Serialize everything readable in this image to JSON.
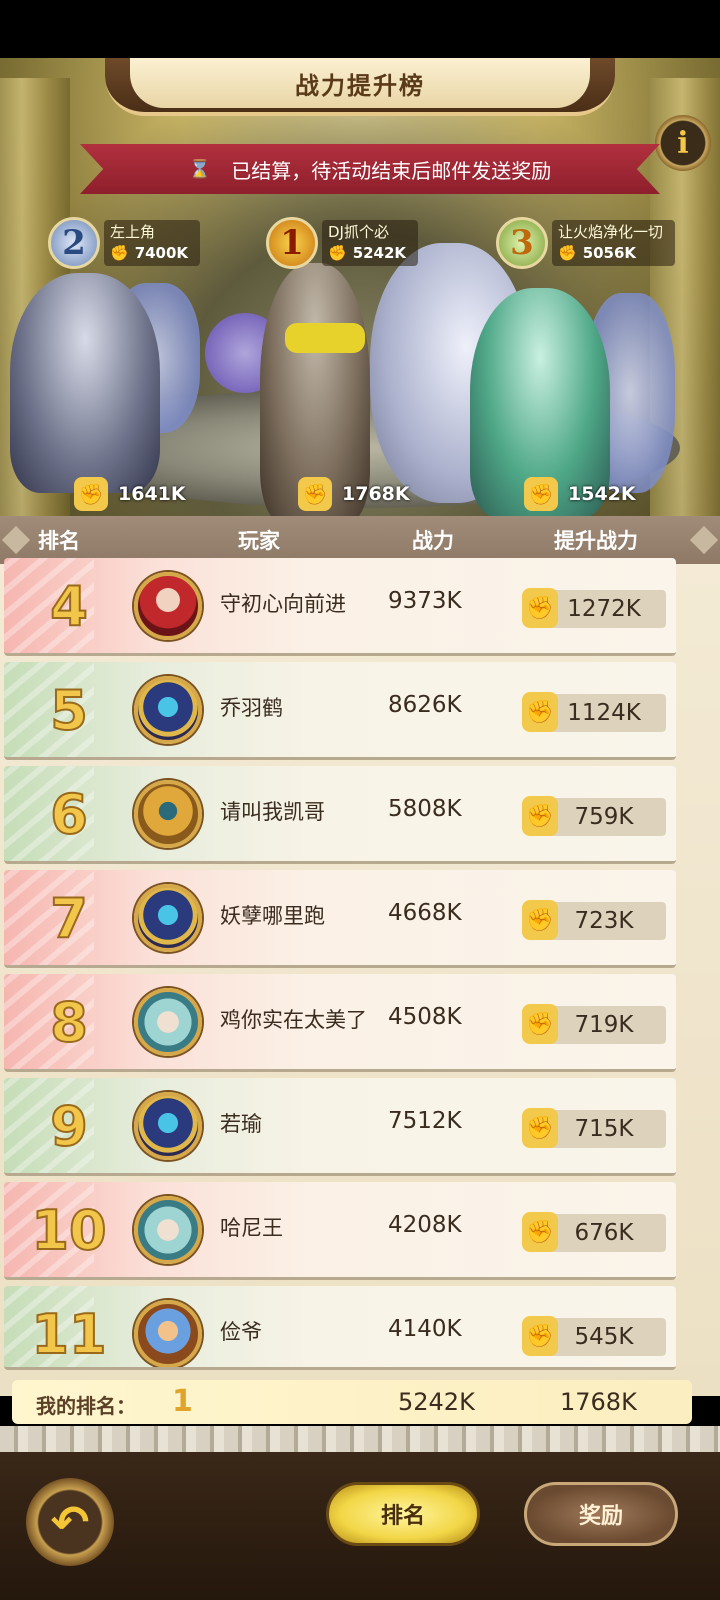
{
  "header": {
    "title": "战力提升榜",
    "info_icon": "i",
    "notice": "已结算，待活动结束后邮件发送奖励"
  },
  "top3": [
    {
      "rank": "2",
      "name": "左上角",
      "power": "7400K",
      "gain": "1641K"
    },
    {
      "rank": "1",
      "name": "DJ抓个必",
      "power": "5242K",
      "gain": "1768K"
    },
    {
      "rank": "3",
      "name": "让火焰净化一切",
      "power": "5056K",
      "gain": "1542K"
    }
  ],
  "columns": {
    "rank": "排名",
    "player": "玩家",
    "power": "战力",
    "gain": "提升战力"
  },
  "rows": [
    {
      "rank": "4",
      "name": "守初心向前进",
      "power": "9373K",
      "gain": "1272K",
      "avatar": "red-hood-avatar"
    },
    {
      "rank": "5",
      "name": "乔羽鹤",
      "power": "8626K",
      "gain": "1124K",
      "avatar": "armored-knight-avatar"
    },
    {
      "rank": "6",
      "name": "请叫我凯哥",
      "power": "5808K",
      "gain": "759K",
      "avatar": "golden-pharaoh-avatar"
    },
    {
      "rank": "7",
      "name": "妖孽哪里跑",
      "power": "4668K",
      "gain": "723K",
      "avatar": "armored-knight-avatar"
    },
    {
      "rank": "8",
      "name": "鸡你实在太美了",
      "power": "4508K",
      "gain": "719K",
      "avatar": "elf-girl-avatar"
    },
    {
      "rank": "9",
      "name": "若瑜",
      "power": "7512K",
      "gain": "715K",
      "avatar": "armored-knight-avatar"
    },
    {
      "rank": "10",
      "name": "哈尼王",
      "power": "4208K",
      "gain": "676K",
      "avatar": "elf-girl-avatar"
    },
    {
      "rank": "11",
      "name": "俭爷",
      "power": "4140K",
      "gain": "545K",
      "avatar": "beast-duo-avatar"
    }
  ],
  "my_rank": {
    "label": "我的排名：",
    "rank": "1",
    "power": "5242K",
    "gain": "1768K"
  },
  "footer": {
    "back_icon": "back-arrow-icon",
    "tab_rank": "排名",
    "tab_reward": "奖励"
  },
  "colors": {
    "accent_gold": "#f2c64a",
    "ribbon_red": "#a32836",
    "header_brown": "#8d7965"
  }
}
